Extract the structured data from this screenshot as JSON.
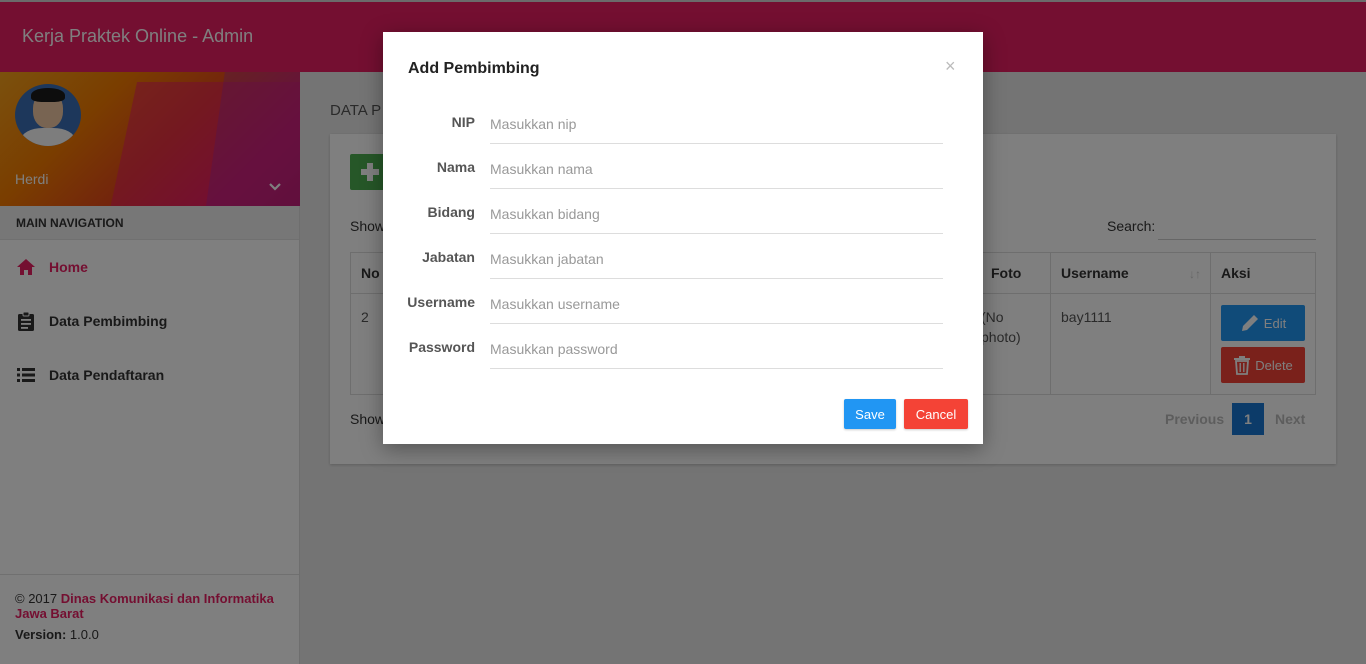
{
  "app": {
    "title": "Kerja Praktek Online - Admin"
  },
  "user": {
    "name": "Herdi"
  },
  "sidebar": {
    "nav_header": "MAIN NAVIGATION",
    "items": [
      {
        "label": "Home",
        "icon": "home-icon",
        "active": true
      },
      {
        "label": "Data Pembimbing",
        "icon": "clipboard-icon",
        "active": false
      },
      {
        "label": "Data Pendaftaran",
        "icon": "list-icon",
        "active": false
      }
    ],
    "footer": {
      "copyright": "© 2017",
      "org": "Dinas Komunikasi dan Informatika Jawa Barat",
      "version_label": "Version:",
      "version": "1.0.0"
    }
  },
  "main": {
    "page_title": "DATA P",
    "show_top": "Show",
    "show_bottom": "Show",
    "search_label": "Search:",
    "table": {
      "headers": {
        "no": "No",
        "foto": "Foto",
        "username": "Username",
        "aksi": "Aksi"
      },
      "row": {
        "no": "2",
        "foto": "(No photo)",
        "username": "bay1111"
      },
      "edit_label": "Edit",
      "delete_label": "Delete"
    },
    "pagination": {
      "previous": "Previous",
      "current": "1",
      "next": "Next"
    }
  },
  "modal": {
    "title": "Add Pembimbing",
    "close": "×",
    "fields": [
      {
        "label": "NIP",
        "placeholder": "Masukkan nip"
      },
      {
        "label": "Nama",
        "placeholder": "Masukkan nama"
      },
      {
        "label": "Bidang",
        "placeholder": "Masukkan bidang"
      },
      {
        "label": "Jabatan",
        "placeholder": "Masukkan jabatan"
      },
      {
        "label": "Username",
        "placeholder": "Masukkan username"
      },
      {
        "label": "Password",
        "placeholder": "Masukkan password"
      }
    ],
    "save_label": "Save",
    "cancel_label": "Cancel"
  },
  "colors": {
    "primary": "#e91e63",
    "save": "#2196f3",
    "cancel": "#f44336",
    "add": "#4caf50"
  }
}
